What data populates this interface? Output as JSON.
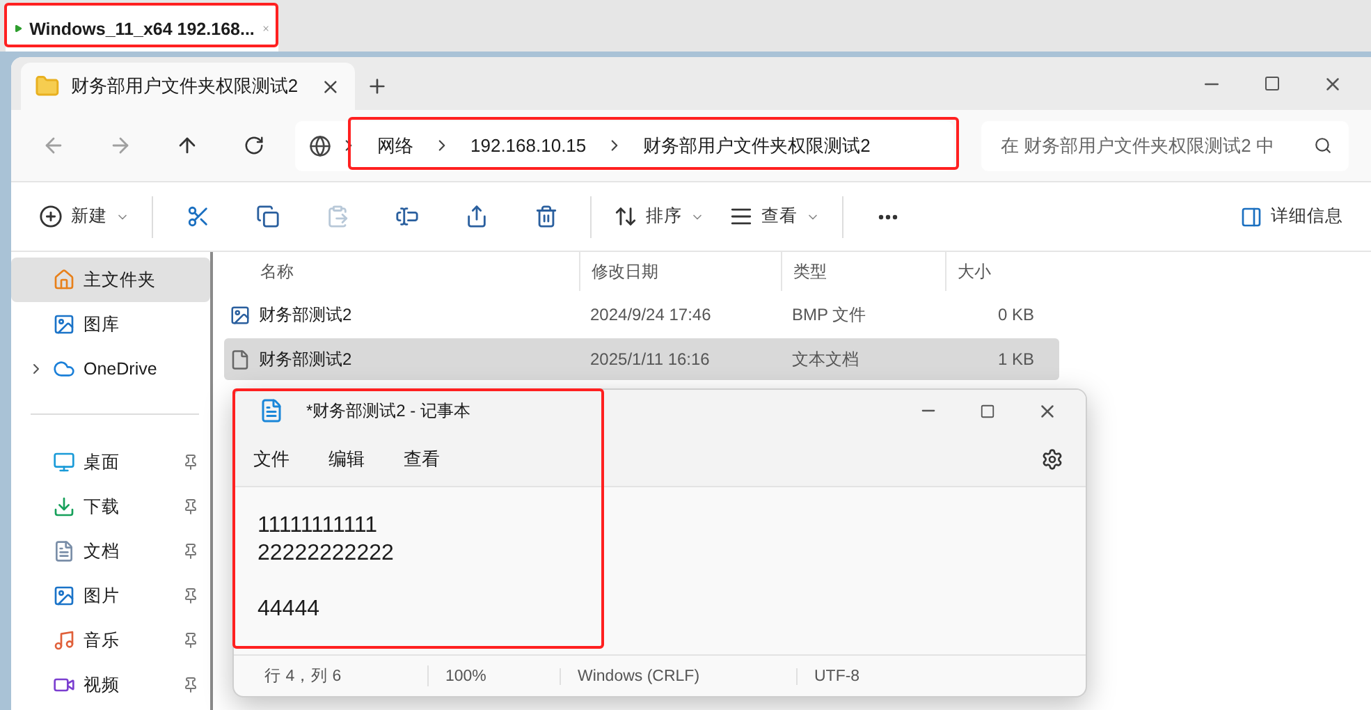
{
  "vm_tab": {
    "title": "Windows_11_x64 192.168...",
    "selected": true
  },
  "explorer": {
    "tab": {
      "title": "财务部用户文件夹权限测试2"
    },
    "address": {
      "segments": [
        "网络",
        "192.168.10.15",
        "财务部用户文件夹权限测试2"
      ]
    },
    "search": {
      "placeholder": "在 财务部用户文件夹权限测试2 中"
    },
    "toolbar": {
      "new": "新建",
      "actions": [
        {
          "kind": "cut",
          "disabled": false
        },
        {
          "kind": "copy",
          "disabled": false
        },
        {
          "kind": "paste",
          "disabled": true
        },
        {
          "kind": "rename",
          "disabled": false
        },
        {
          "kind": "share",
          "disabled": false
        },
        {
          "kind": "delete",
          "disabled": false
        }
      ],
      "sort": "排序",
      "view": "查看",
      "details": "详细信息"
    },
    "sidebar": {
      "top": [
        {
          "label": "主文件夹",
          "selected": true,
          "expandable": false
        },
        {
          "label": "图库",
          "selected": false,
          "expandable": false
        },
        {
          "label": "OneDrive",
          "selected": false,
          "expandable": true
        }
      ],
      "pinned": [
        {
          "label": "桌面",
          "pinned": true
        },
        {
          "label": "下载",
          "pinned": true
        },
        {
          "label": "文档",
          "pinned": true
        },
        {
          "label": "图片",
          "pinned": true
        },
        {
          "label": "音乐",
          "pinned": true
        },
        {
          "label": "视频",
          "pinned": true
        }
      ]
    },
    "table": {
      "columns": [
        "名称",
        "修改日期",
        "类型",
        "大小"
      ],
      "rows": [
        {
          "kind": "image",
          "name": "财务部测试2",
          "modified": "2024/9/24 17:46",
          "type": "BMP 文件",
          "size": "0 KB",
          "selected": false
        },
        {
          "kind": "text",
          "name": "财务部测试2",
          "modified": "2025/1/11 16:16",
          "type": "文本文档",
          "size": "1 KB",
          "selected": true
        }
      ]
    }
  },
  "notepad": {
    "title": "*财务部测试2 - 记事本",
    "menu": [
      "文件",
      "编辑",
      "查看"
    ],
    "content": "11111111111\n22222222222\n\n44444",
    "status": [
      "行 4，列 6",
      "100%",
      "Windows (CRLF)",
      "UTF-8"
    ]
  }
}
